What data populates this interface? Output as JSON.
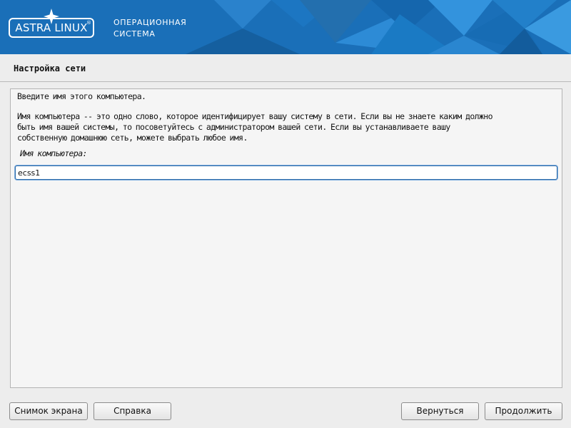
{
  "banner": {
    "logo_text": "ASTRA LINUX",
    "logo_trademark": "®",
    "tagline_line1": "ОПЕРАЦИОННАЯ",
    "tagline_line2": "СИСТЕМА",
    "colors": {
      "background": "#1a6fb8",
      "text": "#ffffff"
    }
  },
  "page": {
    "title": "Настройка сети"
  },
  "content": {
    "prompt": "Введите имя этого компьютера.",
    "description_lines": [
      "Имя компьютера -- это одно слово, которое идентифицирует вашу систему в сети. Если вы не знаете каким должно",
      "быть имя вашей системы, то посоветуйтесь с администратором вашей сети. Если вы устанавливаете вашу",
      "собственную домашнюю сеть, можете выбрать любое имя."
    ],
    "field_label": "Имя компьютера:",
    "hostname_value": "ecss1"
  },
  "buttons": {
    "screenshot": "Снимок экрана",
    "help": "Справка",
    "back": "Вернуться",
    "continue": "Продолжить"
  },
  "colors": {
    "input_focus_border": "#2c6aa6",
    "panel_background": "#f5f5f5",
    "window_background": "#ededed"
  }
}
